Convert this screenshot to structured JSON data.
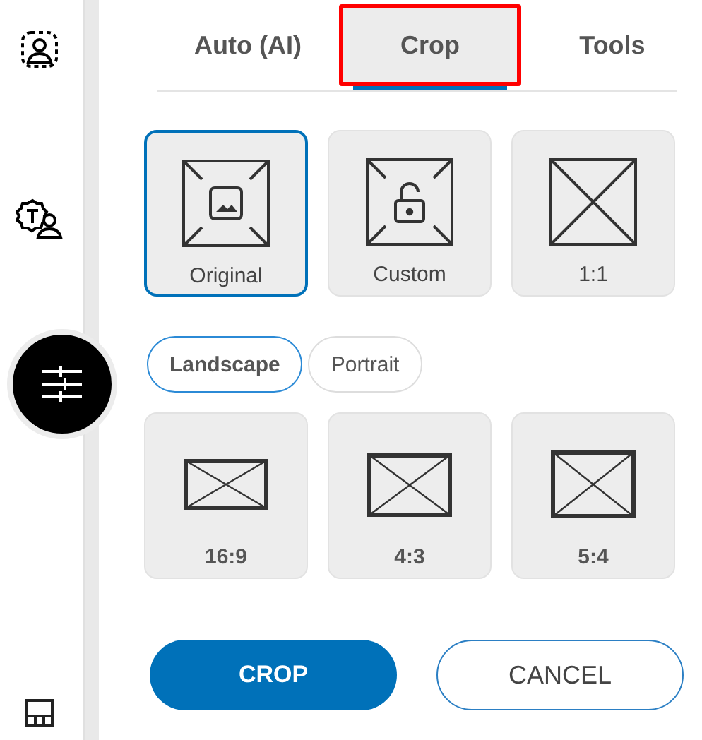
{
  "sidebar": {
    "items": [
      {
        "kind": "portrait",
        "selected": false
      },
      {
        "kind": "badge-person",
        "selected": false
      },
      {
        "kind": "sliders",
        "selected": true
      },
      {
        "kind": "layout",
        "selected": false
      }
    ]
  },
  "tabs": [
    {
      "label": "Auto (AI)",
      "selected": false,
      "highlighted": false
    },
    {
      "label": "Crop",
      "selected": true,
      "highlighted": true
    },
    {
      "label": "Tools",
      "selected": false,
      "highlighted": false
    }
  ],
  "presets": [
    {
      "label": "Original",
      "kind": "image",
      "selected": true
    },
    {
      "label": "Custom",
      "kind": "lock",
      "selected": false
    },
    {
      "label": "1:1",
      "kind": "square",
      "selected": false
    }
  ],
  "orientations": [
    {
      "label": "Landscape",
      "selected": true
    },
    {
      "label": "Portrait",
      "selected": false
    }
  ],
  "ratios": [
    {
      "label": "16:9",
      "kind": "wide",
      "selected": false
    },
    {
      "label": "4:3",
      "kind": "standard",
      "selected": false
    },
    {
      "label": "5:4",
      "kind": "near-square",
      "selected": false
    }
  ],
  "buttons": [
    {
      "label": "CROP",
      "kind": "primary"
    },
    {
      "label": "CANCEL",
      "kind": "secondary"
    }
  ]
}
